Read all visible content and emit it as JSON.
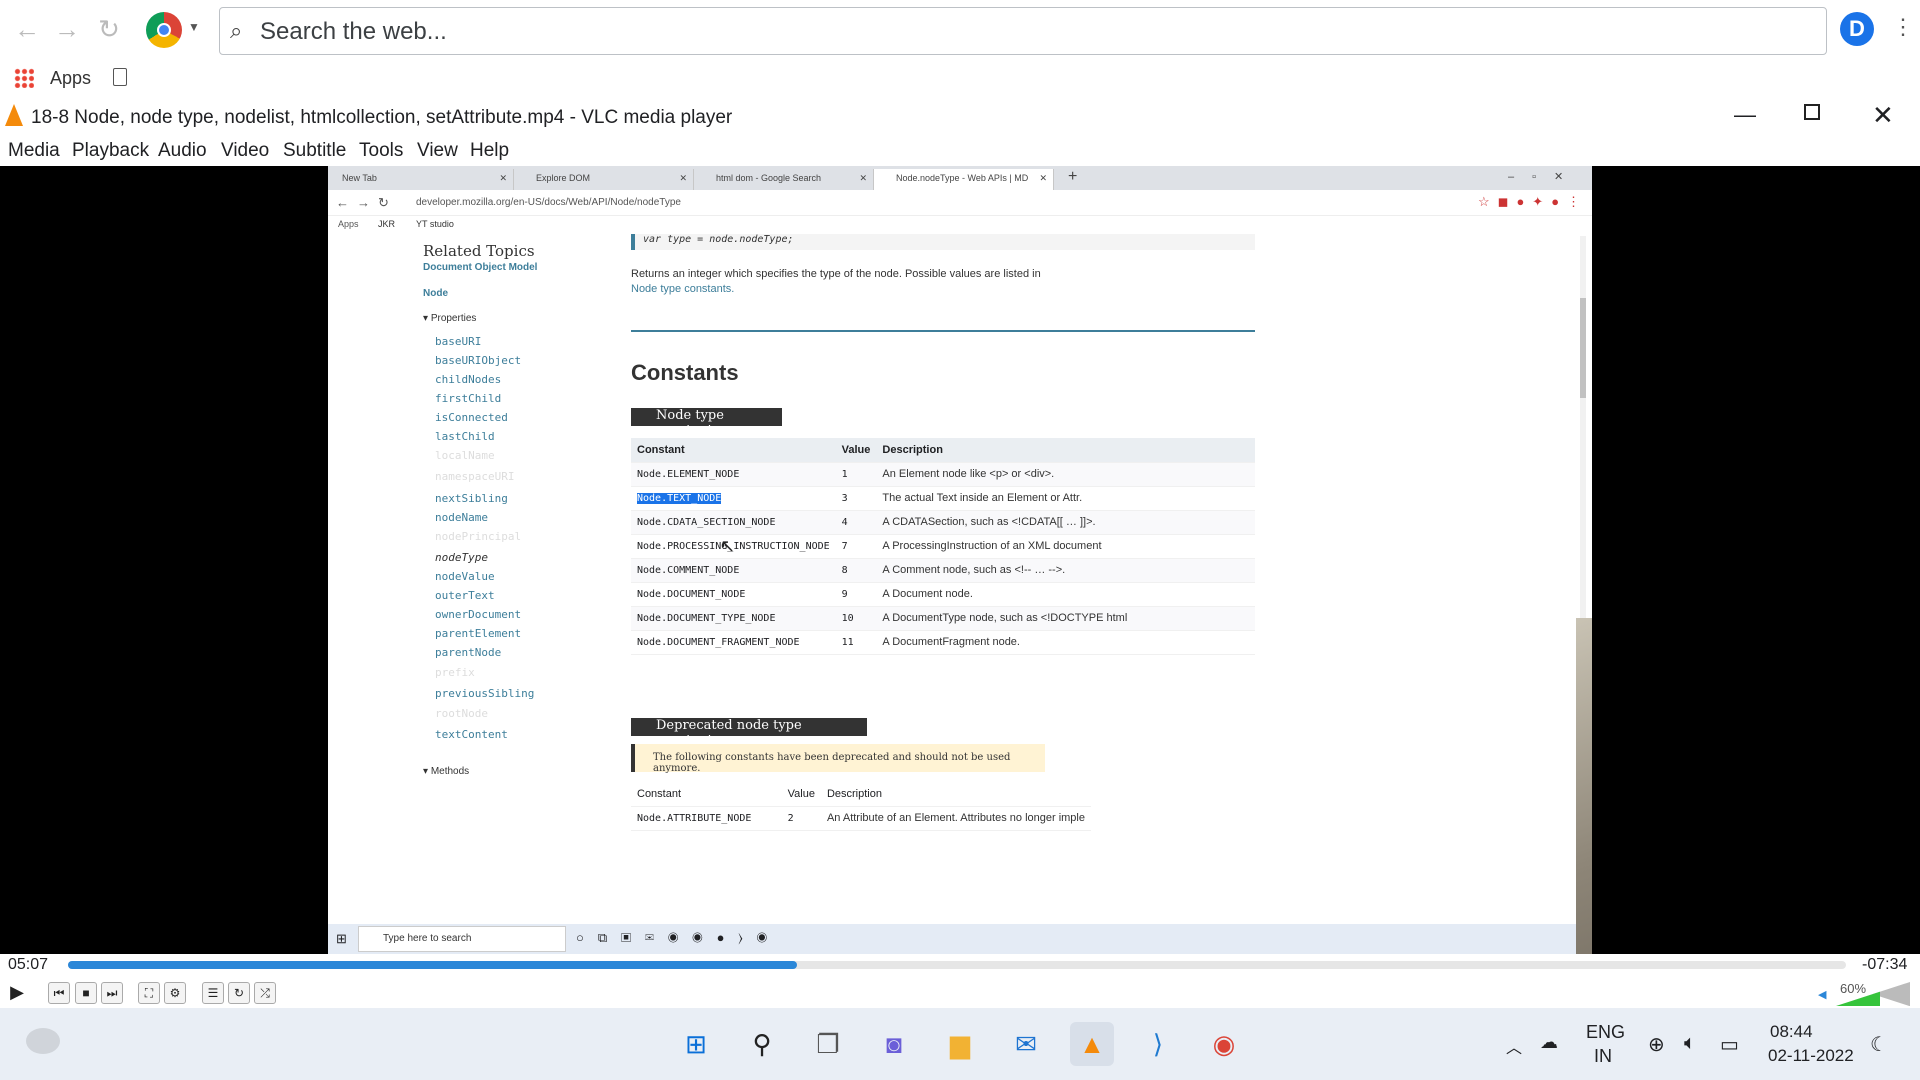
{
  "chrome": {
    "search_placeholder": "Search the web...",
    "bookmarks": {
      "apps": "Apps"
    },
    "profile_initial": "D"
  },
  "vlc": {
    "title": "18-8 Node, node type, nodelist, htmlcollection, setAttribute.mp4 - VLC media player",
    "menu": [
      "Media",
      "Playback",
      "Audio",
      "Video",
      "Subtitle",
      "Tools",
      "View",
      "Help"
    ],
    "elapsed": "05:07",
    "remaining": "-07:34",
    "progress": 0.41,
    "volume": "60%"
  },
  "inner": {
    "tabs": [
      "New Tab",
      "Explore DOM",
      "html dom - Google Search",
      "Node.nodeType - Web APIs | MD"
    ],
    "url": "developer.mozilla.org/en-US/docs/Web/API/Node/nodeType",
    "bookmarks": [
      "Apps",
      "JKR",
      "YT studio"
    ],
    "sidebar": {
      "heading": "Related Topics",
      "dom": "Document Object Model",
      "node": "Node",
      "properties": "Properties",
      "items": [
        "baseURI",
        "baseURIObject",
        "childNodes",
        "firstChild",
        "isConnected",
        "lastChild",
        "localName",
        "namespaceURI",
        "nextSibling",
        "nodeName",
        "nodePrincipal",
        "nodeType",
        "nodeValue",
        "outerText",
        "ownerDocument",
        "parentElement",
        "parentNode",
        "prefix",
        "previousSibling",
        "rootNode",
        "textContent"
      ],
      "methods": "Methods"
    },
    "syntax": "var type = node.nodeType;",
    "returns_text": "Returns an integer which specifies the type of the node. Possible values are listed in",
    "returns_link": "Node type constants.",
    "h_constants": "Constants",
    "h_node_type": "Node type constants",
    "table_headers": [
      "Constant",
      "Value",
      "Description"
    ],
    "rows": [
      [
        "Node.ELEMENT_NODE",
        "1",
        "An Element node like <p> or <div>."
      ],
      [
        "Node.TEXT_NODE",
        "3",
        "The actual Text inside an Element or Attr."
      ],
      [
        "Node.CDATA_SECTION_NODE",
        "4",
        "A CDATASection, such as <!CDATA[[ … ]]>."
      ],
      [
        "Node.PROCESSING_INSTRUCTION_NODE",
        "7",
        "A ProcessingInstruction of an XML document"
      ],
      [
        "Node.COMMENT_NODE",
        "8",
        "A Comment node, such as <!-- … -->."
      ],
      [
        "Node.DOCUMENT_NODE",
        "9",
        "A Document node."
      ],
      [
        "Node.DOCUMENT_TYPE_NODE",
        "10",
        "A DocumentType node, such as <!DOCTYPE html"
      ],
      [
        "Node.DOCUMENT_FRAGMENT_NODE",
        "11",
        "A DocumentFragment node."
      ]
    ],
    "h_deprecated": "Deprecated node type constants",
    "deprecated_note": "The following constants have been deprecated and should not be used anymore.",
    "dep_headers": [
      "Constant",
      "Value",
      "Description"
    ],
    "dep_row": [
      "Node.ATTRIBUTE_NODE",
      "2",
      "An Attribute of an Element. Attributes no longer imple"
    ],
    "taskbar_search": "Type here to search"
  },
  "taskbar": {
    "lang": "ENG",
    "region": "IN",
    "time": "08:44",
    "date": "02-11-2022"
  }
}
